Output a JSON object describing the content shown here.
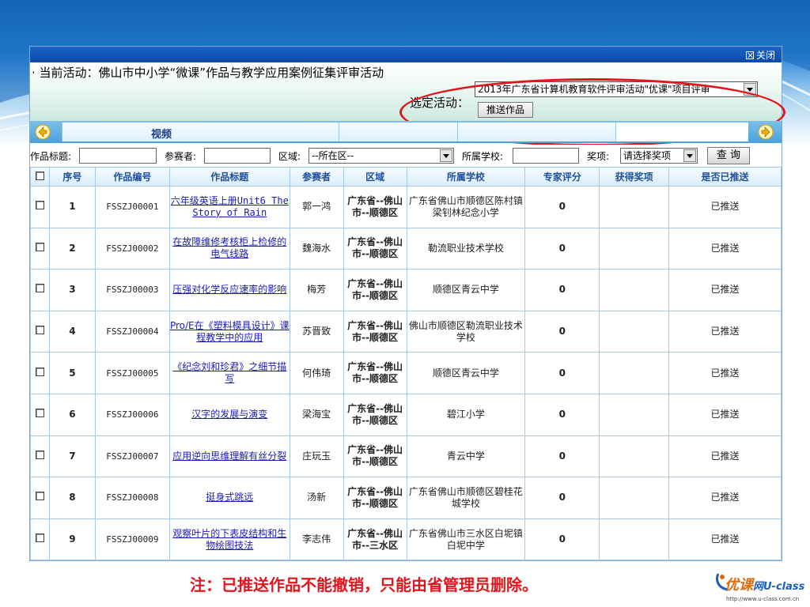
{
  "window": {
    "close_label": "关闭",
    "current_activity": "· 当前活动：佛山市中小学“微课”作品与教学应用案例征集评审活动",
    "select_activity_label": "选定活动：",
    "selected_activity": "2013年广东省计算机教育软件评审活动\"优课\"项目评审",
    "push_button": "推送作品"
  },
  "tabs": {
    "active_tab": "视频"
  },
  "filters": {
    "title_label": "作品标题:",
    "participant_label": "参赛者:",
    "region_label": "区域:",
    "region_value": "--所在区--",
    "school_label": "所属学校:",
    "award_label": "奖项:",
    "award_value": "请选择奖项",
    "query_button": "查 询"
  },
  "table": {
    "headers": [
      "序号",
      "作品编号",
      "作品标题",
      "参赛者",
      "区域",
      "所属学校",
      "专家评分",
      "获得奖项",
      "是否已推送"
    ],
    "rows": [
      {
        "seq": "1",
        "code": "FSSZJ00001",
        "title": "六年级英语上册Unit6 The Story of Rain",
        "participant": "郭一鸿",
        "region": "广东省--佛山市--顺德区",
        "school": "广东省佛山市顺德区陈村镇梁钊林纪念小学",
        "score": "0",
        "award": "",
        "pushed": "已推送"
      },
      {
        "seq": "2",
        "code": "FSSZJ00002",
        "title": "在故障维修考核柜上检修的电气线路",
        "participant": "魏海水",
        "region": "广东省--佛山市--顺德区",
        "school": "勒流职业技术学校",
        "score": "0",
        "award": "",
        "pushed": "已推送"
      },
      {
        "seq": "3",
        "code": "FSSZJ00003",
        "title": "压强对化学反应速率的影响",
        "participant": "梅芳",
        "region": "广东省--佛山市--顺德区",
        "school": "顺德区青云中学",
        "score": "0",
        "award": "",
        "pushed": "已推送"
      },
      {
        "seq": "4",
        "code": "FSSZJ00004",
        "title": "Pro/E在《塑料模具设计》课程教学中的应用",
        "participant": "苏晋致",
        "region": "广东省--佛山市--顺德区",
        "school": "佛山市顺德区勒流职业技术学校",
        "score": "0",
        "award": "",
        "pushed": "已推送"
      },
      {
        "seq": "5",
        "code": "FSSZJ00005",
        "title": "《纪念刘和珍君》之细节描写",
        "participant": "何伟琦",
        "region": "广东省--佛山市--顺德区",
        "school": "顺德区青云中学",
        "score": "0",
        "award": "",
        "pushed": "已推送"
      },
      {
        "seq": "6",
        "code": "FSSZJ00006",
        "title": "汉字的发展与演变",
        "participant": "梁海宝",
        "region": "广东省--佛山市--顺德区",
        "school": "碧江小学",
        "score": "0",
        "award": "",
        "pushed": "已推送"
      },
      {
        "seq": "7",
        "code": "FSSZJ00007",
        "title": "应用逆向思维理解有丝分裂",
        "participant": "庄玩玉",
        "region": "广东省--佛山市--顺德区",
        "school": "青云中学",
        "score": "0",
        "award": "",
        "pushed": "已推送"
      },
      {
        "seq": "8",
        "code": "FSSZJ00008",
        "title": "挺身式跳远",
        "participant": "汤新",
        "region": "广东省--佛山市--顺德区",
        "school": "广东省佛山市顺德区碧桂花城学校",
        "score": "0",
        "award": "",
        "pushed": "已推送"
      },
      {
        "seq": "9",
        "code": "FSSZJ00009",
        "title": "观察叶片的下表皮结构和生物绘图技法",
        "participant": "李志伟",
        "region": "广东省--佛山市--三水区",
        "school": "广东省佛山市三水区白坭镇白坭中学",
        "score": "0",
        "award": "",
        "pushed": "已推送"
      }
    ]
  },
  "note": "注：已推送作品不能撤销，只能由省管理员删除。",
  "logo": {
    "brand": "优课",
    "brand2": "网U-class",
    "url": "http://www.u-class.com.cn"
  },
  "colors": {
    "accent_red": "#e0161c",
    "header_blue": "#0b4aa8",
    "region_green": "#2a9a10",
    "score_orange": "#e07a00"
  }
}
